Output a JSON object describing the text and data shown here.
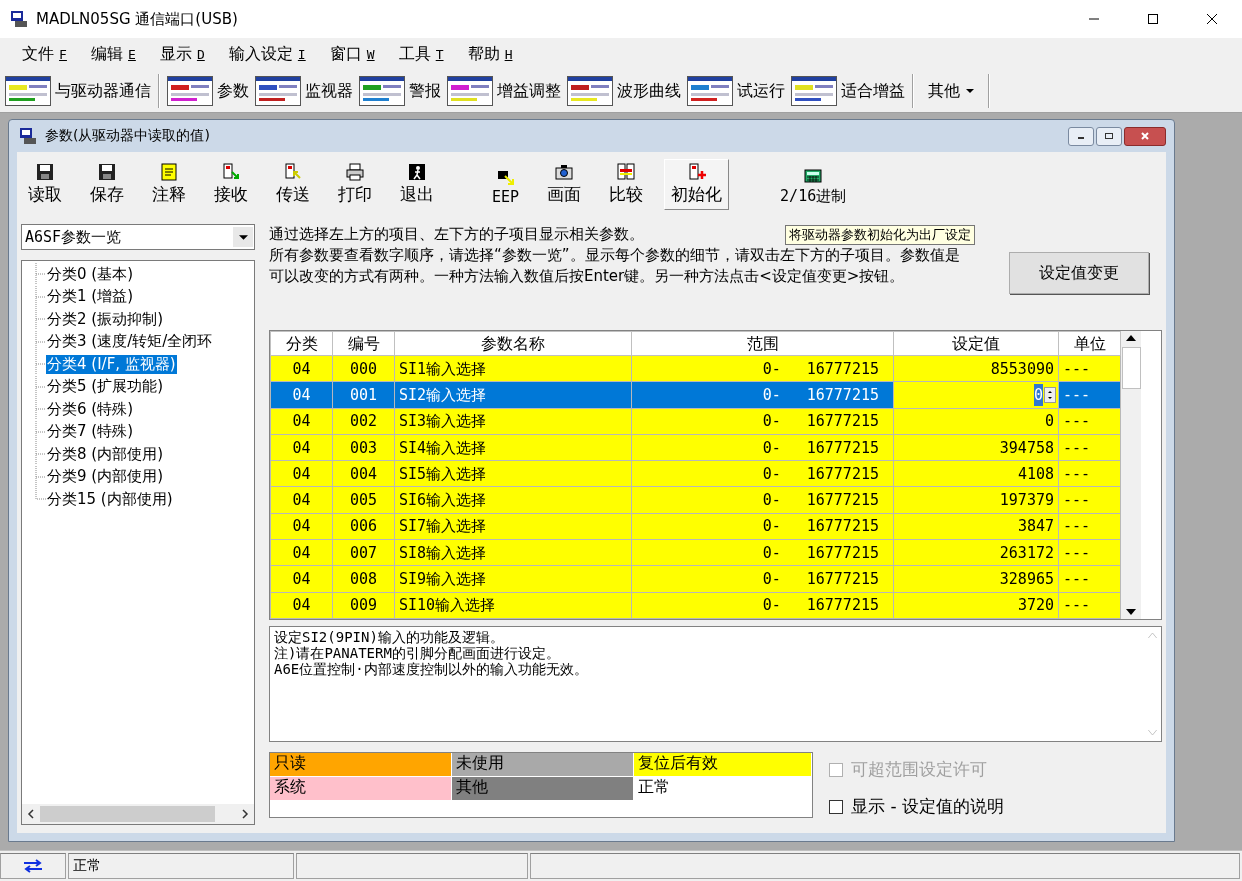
{
  "window": {
    "title": "MADLN05SG  通信端口(USB)"
  },
  "menu": [
    {
      "label": "文件",
      "key": "F"
    },
    {
      "label": "编辑",
      "key": "E"
    },
    {
      "label": "显示",
      "key": "D"
    },
    {
      "label": "输入设定",
      "key": "I"
    },
    {
      "label": "窗口",
      "key": "W"
    },
    {
      "label": "工具",
      "key": "T"
    },
    {
      "label": "帮助",
      "key": "H"
    }
  ],
  "toolbar": [
    {
      "label": "与驱动器通信",
      "separator_before": false
    },
    {
      "label": "参数",
      "separator_before": true
    },
    {
      "label": "监视器",
      "separator_before": false
    },
    {
      "label": "警报",
      "separator_before": false
    },
    {
      "label": "增益调整",
      "separator_before": false
    },
    {
      "label": "波形曲线",
      "separator_before": false
    },
    {
      "label": "试运行",
      "separator_before": false
    },
    {
      "label": "适合增益",
      "separator_before": false
    }
  ],
  "toolbar_more": {
    "label": "其他"
  },
  "child": {
    "title": "参数(从驱动器中读取的值)",
    "tools": [
      {
        "label": "读取",
        "kind": "disk",
        "highlighted": false
      },
      {
        "label": "保存",
        "kind": "disk",
        "highlighted": false
      },
      {
        "label": "注释",
        "kind": "note",
        "highlighted": false
      },
      {
        "label": "接收",
        "kind": "receive",
        "highlighted": false
      },
      {
        "label": "传送",
        "kind": "send",
        "highlighted": false
      },
      {
        "label": "打印",
        "kind": "print",
        "highlighted": false
      },
      {
        "label": "退出",
        "kind": "exit",
        "highlighted": false
      },
      {
        "label": "EEP",
        "kind": "eep",
        "highlighted": false
      },
      {
        "label": "画面",
        "kind": "camera",
        "highlighted": false
      },
      {
        "label": "比较",
        "kind": "compare",
        "highlighted": false
      },
      {
        "label": "初始化",
        "kind": "init",
        "highlighted": true
      },
      {
        "label": "2/16进制",
        "kind": "calc",
        "highlighted": false
      }
    ],
    "tooltip": "将驱动器参数初始化为出厂设定",
    "combo": {
      "value": "A6SF参数一览"
    },
    "tree": [
      {
        "label": "分类0 (基本)",
        "selected": false
      },
      {
        "label": "分类1 (增益)",
        "selected": false
      },
      {
        "label": "分类2 (振动抑制)",
        "selected": false
      },
      {
        "label": "分类3 (速度/转矩/全闭环",
        "selected": false
      },
      {
        "label": "分类4 (I/F, 监视器)",
        "selected": true
      },
      {
        "label": "分类5 (扩展功能)",
        "selected": false
      },
      {
        "label": "分类6 (特殊)",
        "selected": false
      },
      {
        "label": "分类7 (特殊)",
        "selected": false
      },
      {
        "label": "分类8 (内部使用)",
        "selected": false
      },
      {
        "label": "分类9 (内部使用)",
        "selected": false
      },
      {
        "label": "分类15 (内部使用)",
        "selected": false
      }
    ],
    "description": [
      "通过选择左上方的项目、左下方的子项目显示相关参数。",
      "所有参数要查看数字顺序，请选择“参数一览”。显示每个参数的细节，请双击左下方的子项目。参数值是可以改变的方式有两种。一种方法输入数值后按Enter键。另一种方法点击<设定值变更>按钮。"
    ],
    "change_button": "设定值变更",
    "table": {
      "columns": [
        "分类",
        "编号",
        "参数名称",
        "范围",
        "设定值",
        "单位"
      ],
      "rows": [
        {
          "cat": "04",
          "no": "000",
          "name": "SI1输入选择",
          "min": "0-",
          "max": "16777215",
          "value": "8553090",
          "unit": "---",
          "selected": false,
          "color": "#ffff00"
        },
        {
          "cat": "04",
          "no": "001",
          "name": "SI2输入选择",
          "min": "0-",
          "max": "16777215",
          "value": "0",
          "unit": "---",
          "selected": true,
          "color": "#ffff00"
        },
        {
          "cat": "04",
          "no": "002",
          "name": "SI3输入选择",
          "min": "0-",
          "max": "16777215",
          "value": "0",
          "unit": "---",
          "selected": false,
          "color": "#ffff00"
        },
        {
          "cat": "04",
          "no": "003",
          "name": "SI4输入选择",
          "min": "0-",
          "max": "16777215",
          "value": "394758",
          "unit": "---",
          "selected": false,
          "color": "#ffff00"
        },
        {
          "cat": "04",
          "no": "004",
          "name": "SI5输入选择",
          "min": "0-",
          "max": "16777215",
          "value": "4108",
          "unit": "---",
          "selected": false,
          "color": "#ffff00"
        },
        {
          "cat": "04",
          "no": "005",
          "name": "SI6输入选择",
          "min": "0-",
          "max": "16777215",
          "value": "197379",
          "unit": "---",
          "selected": false,
          "color": "#ffff00"
        },
        {
          "cat": "04",
          "no": "006",
          "name": "SI7输入选择",
          "min": "0-",
          "max": "16777215",
          "value": "3847",
          "unit": "---",
          "selected": false,
          "color": "#ffff00"
        },
        {
          "cat": "04",
          "no": "007",
          "name": "SI8输入选择",
          "min": "0-",
          "max": "16777215",
          "value": "263172",
          "unit": "---",
          "selected": false,
          "color": "#ffff00"
        },
        {
          "cat": "04",
          "no": "008",
          "name": "SI9输入选择",
          "min": "0-",
          "max": "16777215",
          "value": "328965",
          "unit": "---",
          "selected": false,
          "color": "#ffff00"
        },
        {
          "cat": "04",
          "no": "009",
          "name": "SI10输入选择",
          "min": "0-",
          "max": "16777215",
          "value": "3720",
          "unit": "---",
          "selected": false,
          "color": "#ffff00"
        }
      ]
    },
    "detail": [
      "设定SI2(9PIN)输入的功能及逻辑。",
      "注)请在PANATERM的引脚分配画面进行设定。",
      "A6E位置控制·内部速度控制以外的输入功能无效。"
    ],
    "legend": [
      {
        "label": "只读",
        "color": "#ffa500"
      },
      {
        "label": "未使用",
        "color": "#a9a9a9"
      },
      {
        "label": "复位后有效",
        "color": "#ffff00"
      },
      {
        "label": "系统",
        "color": "#ffc0cb"
      },
      {
        "label": "其他",
        "color": "#808080"
      },
      {
        "label": "正常",
        "color": "#ffffff"
      }
    ],
    "options": [
      {
        "label": "可超范围设定许可",
        "checked": false,
        "disabled": true
      },
      {
        "label": "显示 - 设定值的说明",
        "checked": false,
        "disabled": false
      }
    ]
  },
  "status_bar": {
    "text": "正常"
  }
}
